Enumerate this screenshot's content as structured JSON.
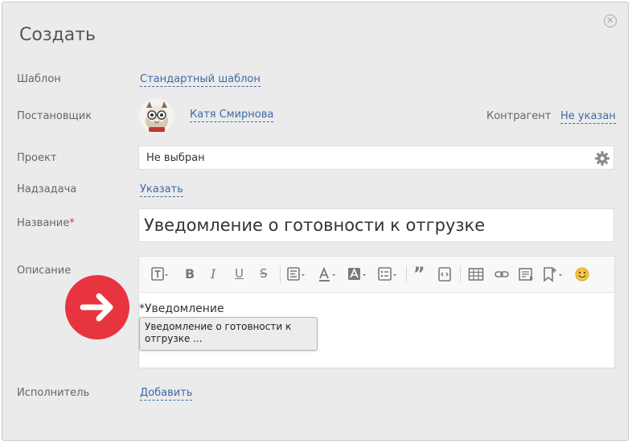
{
  "dialog": {
    "title": "Создать",
    "close_icon": "close-icon"
  },
  "template": {
    "label": "Шаблон",
    "value": "Стандартный шаблон"
  },
  "assigner": {
    "label": "Постановщик",
    "name": "Катя Смирнова"
  },
  "counterparty": {
    "label": "Контрагент",
    "value": "Не указан"
  },
  "project": {
    "label": "Проект",
    "value": "Не выбран"
  },
  "parent_task": {
    "label": "Надзадача",
    "action": "Указать"
  },
  "name_field": {
    "label": "Название",
    "required_mark": "*",
    "value": "Уведомление о готовности к отгрузке"
  },
  "description": {
    "label": "Описание",
    "content_label": "*Уведомление",
    "tooltip": "Уведомление о готовности к отгрузке ..."
  },
  "executor": {
    "label": "Исполнитель",
    "action": "Добавить"
  },
  "colors": {
    "accent_red": "#e8343f",
    "link": "#3c6aa6"
  }
}
